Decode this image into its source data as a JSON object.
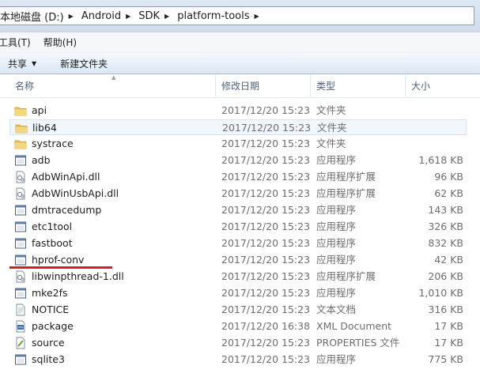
{
  "address_bar": {
    "segments": [
      "本地磁盘 (D:)",
      "Android",
      "SDK",
      "platform-tools"
    ]
  },
  "menu": {
    "items": [
      "工具(T)",
      "帮助(H)"
    ]
  },
  "toolbar": {
    "share_label": "共享",
    "new_folder_label": "新建文件夹"
  },
  "columns": {
    "name": "名称",
    "date": "修改日期",
    "type": "类型",
    "size": "大小"
  },
  "files": [
    {
      "name": "api",
      "date": "2017/12/20 15:23",
      "type": "文件夹",
      "size": "",
      "icon": "folder-icon"
    },
    {
      "name": "lib64",
      "date": "2017/12/20 15:23",
      "type": "文件夹",
      "size": "",
      "icon": "folder-icon"
    },
    {
      "name": "systrace",
      "date": "2017/12/20 15:23",
      "type": "文件夹",
      "size": "",
      "icon": "folder-icon"
    },
    {
      "name": "adb",
      "date": "2017/12/20 15:23",
      "type": "应用程序",
      "size": "1,618 KB",
      "icon": "application-icon"
    },
    {
      "name": "AdbWinApi.dll",
      "date": "2017/12/20 15:23",
      "type": "应用程序扩展",
      "size": "96 KB",
      "icon": "dll-icon"
    },
    {
      "name": "AdbWinUsbApi.dll",
      "date": "2017/12/20 15:23",
      "type": "应用程序扩展",
      "size": "62 KB",
      "icon": "dll-icon"
    },
    {
      "name": "dmtracedump",
      "date": "2017/12/20 15:23",
      "type": "应用程序",
      "size": "143 KB",
      "icon": "application-icon"
    },
    {
      "name": "etc1tool",
      "date": "2017/12/20 15:23",
      "type": "应用程序",
      "size": "326 KB",
      "icon": "application-icon"
    },
    {
      "name": "fastboot",
      "date": "2017/12/20 15:23",
      "type": "应用程序",
      "size": "832 KB",
      "icon": "application-icon"
    },
    {
      "name": "hprof-conv",
      "date": "2017/12/20 15:23",
      "type": "应用程序",
      "size": "42 KB",
      "icon": "application-icon"
    },
    {
      "name": "libwinpthread-1.dll",
      "date": "2017/12/20 15:23",
      "type": "应用程序扩展",
      "size": "206 KB",
      "icon": "dll-icon"
    },
    {
      "name": "mke2fs",
      "date": "2017/12/20 15:23",
      "type": "应用程序",
      "size": "1,010 KB",
      "icon": "application-icon"
    },
    {
      "name": "NOTICE",
      "date": "2017/12/20 15:23",
      "type": "文本文档",
      "size": "316 KB",
      "icon": "text-document-icon"
    },
    {
      "name": "package",
      "date": "2017/12/20 16:38",
      "type": "XML Document",
      "size": "17 KB",
      "icon": "xml-document-icon"
    },
    {
      "name": "source",
      "date": "2017/12/20 15:23",
      "type": "PROPERTIES 文件",
      "size": "17 KB",
      "icon": "properties-file-icon"
    },
    {
      "name": "sqlite3",
      "date": "2017/12/20 15:23",
      "type": "应用程序",
      "size": "775 KB",
      "icon": "application-icon"
    }
  ],
  "selected_row": "lib64",
  "colors": {
    "folder": "#e8c15a",
    "annotation": "#d62020",
    "selection": "#f0f6fc"
  }
}
